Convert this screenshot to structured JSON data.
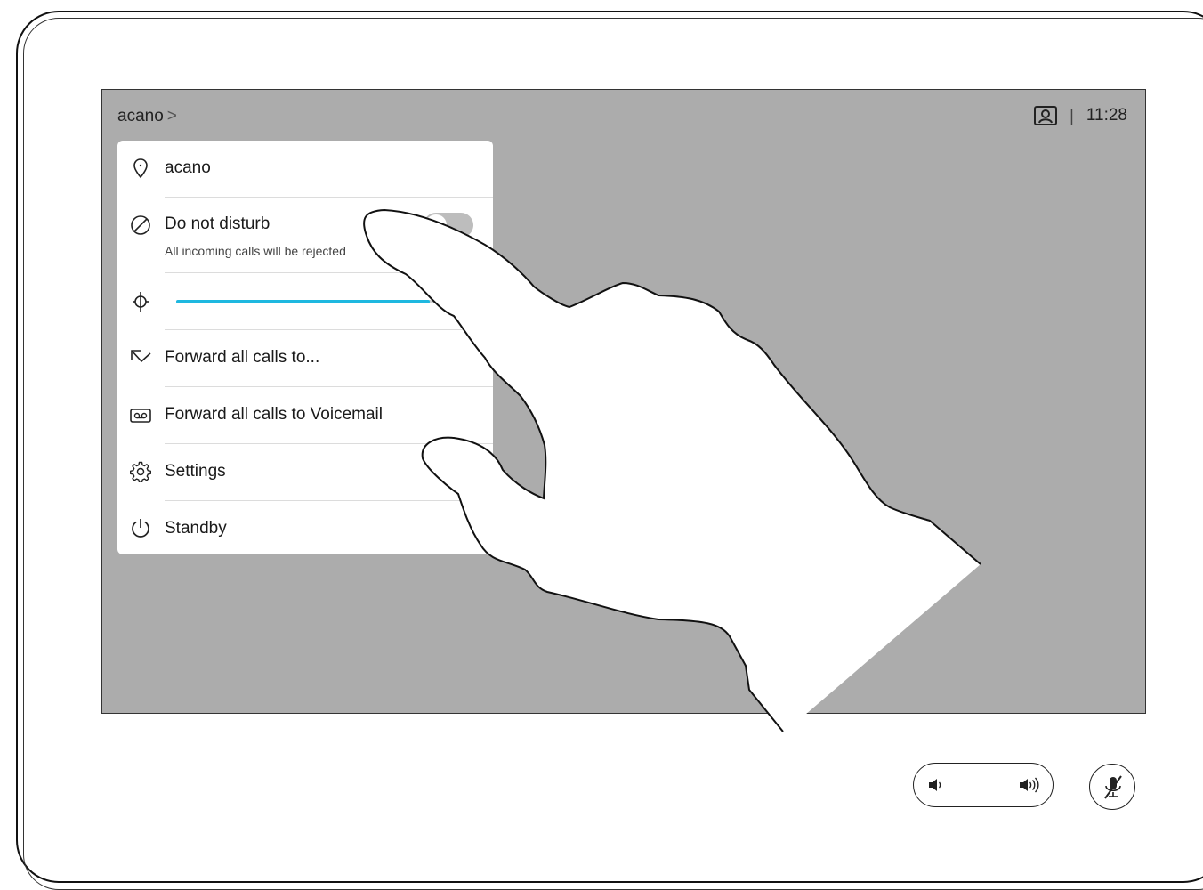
{
  "header": {
    "title": "acano",
    "title_chevron": ">",
    "selfview_icon": "selfview-icon",
    "separator": "|",
    "clock": "11:28"
  },
  "menu": {
    "items": [
      {
        "icon": "location-pin-icon",
        "label": "acano"
      },
      {
        "icon": "do-not-disturb-icon",
        "label": "Do not disturb",
        "sublabel": "All incoming calls will be rejected",
        "toggle_on": false
      },
      {
        "icon": "brightness-icon",
        "label": "",
        "slider_value": 0.95
      },
      {
        "icon": "forward-arrow-icon",
        "label": "Forward all calls to..."
      },
      {
        "icon": "voicemail-icon",
        "label": "Forward all calls to Voicemail"
      },
      {
        "icon": "gear-icon",
        "label": "Settings"
      },
      {
        "icon": "power-icon",
        "label": "Standby"
      }
    ]
  },
  "controls": {
    "volume_down_icon": "volume-down-icon",
    "volume_up_icon": "volume-up-icon",
    "mute_icon": "microphone-muted-icon"
  },
  "colors": {
    "screen_bg": "#acacac",
    "accent": "#1eb8e0"
  }
}
